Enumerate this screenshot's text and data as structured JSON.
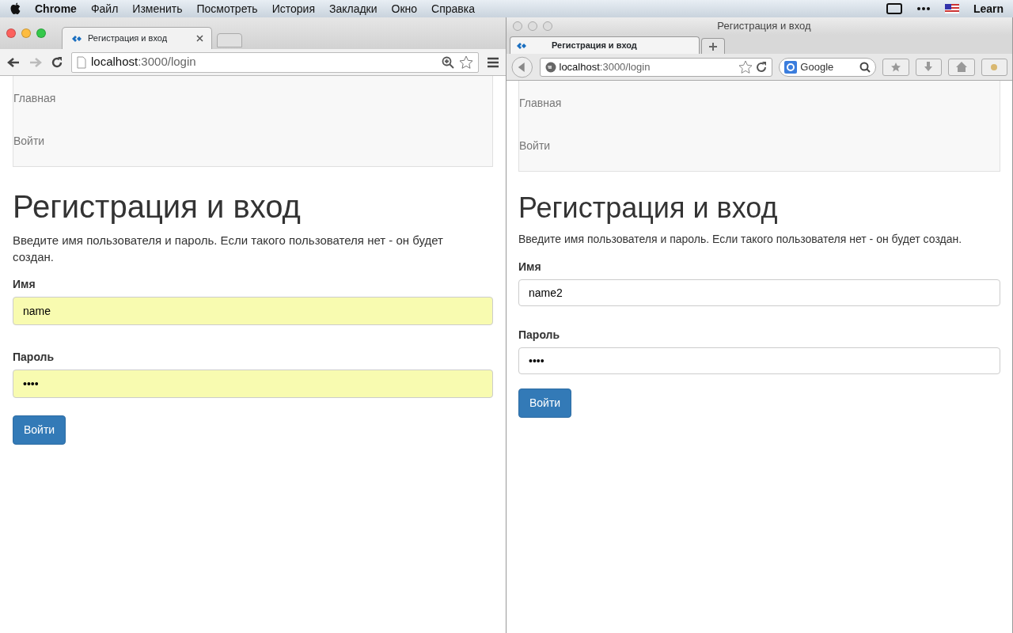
{
  "menu_bar": {
    "app": "Chrome",
    "items": [
      "Файл",
      "Изменить",
      "Посмотреть",
      "История",
      "Закладки",
      "Окно",
      "Справка"
    ],
    "user": "Learn"
  },
  "windows": [
    {
      "kind": "chrome",
      "tab_title": "Регистрация и вход",
      "url_host": "localhost",
      "url_path": ":3000/login",
      "page": {
        "nav": [
          "Главная",
          "Войти"
        ],
        "heading": "Регистрация и вход",
        "intro": "Введите имя пользователя и пароль. Если такого пользователя нет - он будет создан.",
        "fields": [
          {
            "label": "Имя",
            "value": "name",
            "autofilled": true
          },
          {
            "label": "Пароль",
            "value": "••••",
            "autofilled": true
          }
        ],
        "button": "Войти"
      }
    },
    {
      "kind": "firefox",
      "title": "Регистрация и вход",
      "tab_title": "Регистрация и вход",
      "url_host": "localhost",
      "url_path": ":3000/login",
      "search_placeholder": "Google",
      "page": {
        "nav": [
          "Главная",
          "Войти"
        ],
        "heading": "Регистрация и вход",
        "intro": "Введите имя пользователя и пароль. Если такого пользователя нет - он будет создан.",
        "fields": [
          {
            "label": "Имя",
            "value": "name2",
            "autofilled": false
          },
          {
            "label": "Пароль",
            "value": "••••",
            "autofilled": false
          }
        ],
        "button": "Войти"
      }
    }
  ]
}
